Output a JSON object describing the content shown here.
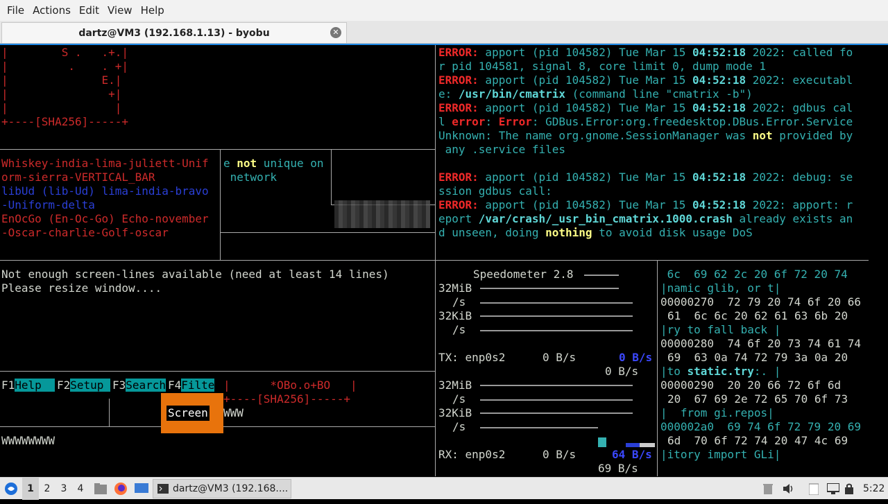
{
  "menubar": {
    "items": [
      "File",
      "Actions",
      "Edit",
      "View",
      "Help"
    ]
  },
  "tab": {
    "title": "dartz@VM3 (192.168.1.13) - byobu"
  },
  "left": {
    "art": [
      "|        S .   .+.|",
      "|         .    . +|",
      "|              E.|",
      "|               +|",
      "|                |",
      "+----[SHA256]-----+"
    ],
    "phon1": "Whiskey-india-lima-juliett-Unif",
    "phon2": "orm-sierra-VERTICAL_BAR",
    "phon3": "libUd (lib-Ud) lima-india-bravo",
    "phon4": "-Uniform-delta",
    "phon5": "EnOcGo (En-Oc-Go) Echo-november",
    "phon6": "-Oscar-charlie-Golf-oscar",
    "mid_pre": "e ",
    "mid_not": "not",
    "mid_post": " unique on",
    "mid_l2": " network",
    "msg1": "Not enough screen-lines available (need at least 14 lines)",
    "msg2": "Please resize window....",
    "fkeys": [
      {
        "num": "F1",
        "label": "Help  "
      },
      {
        "num": "F2",
        "label": "Setup "
      },
      {
        "num": "F3",
        "label": "Search"
      },
      {
        "num": "F4",
        "label": "Filte"
      }
    ],
    "art2_l1": "|      *OBo.o+BO   |",
    "art2_l2": "+----[SHA256]-----+",
    "screen_label": "Screen",
    "www": "WWW",
    "wwww": "WWWWWWWW"
  },
  "errors": {
    "tag": "ERROR:",
    "prefix": " apport (pid 104582) Tue Mar 15 ",
    "time": "04:52:18",
    "l1_post": " 2022: called fo",
    "l2": "r pid 104581, signal 8, core limit 0, dump mode 1",
    "l3_post": " 2022: executabl",
    "l4_pre": "e: ",
    "l4_path": "/usr/bin/cmatrix",
    "l4_post": " (command line \"cmatrix -b\")",
    "l5_post": " 2022: gdbus cal",
    "l6_pre": "l ",
    "l6_error": "error",
    "l6_mid": ": ",
    "l6_Error": "Error",
    "l6_post": ": GDBus.Error:org.freedesktop.DBus.Error.Service",
    "l7_pre": "Unknown: The name org.gnome.SessionManager was ",
    "l7_not": "not",
    "l7_post": " provided by",
    "l8": " any .service files",
    "l9_post": " 2022: debug: se",
    "l10": "ssion gdbus call:",
    "l11_post": " 2022: apport: r",
    "l12_pre": "eport ",
    "l12_path": "/var/crash/_usr_bin_cmatrix.1000.crash",
    "l12_post": " already exists an",
    "l13_pre": "d unseen, doing ",
    "l13_nothing": "nothing",
    "l13_post": " to avoid disk usage DoS"
  },
  "speedometer": {
    "title": "Speedometer 2.8",
    "scale1": "32MiB",
    "unit": "/s",
    "scale2": "32KiB",
    "tx_label": "TX: enp0s2",
    "tx_rate": "0 B/s",
    "tx_cur": "0 B/s",
    "tx_avg": "0 B/s",
    "rx_label": "RX: enp0s2",
    "rx_rate": "0 B/s",
    "rx_cur": "64 B/s",
    "rx_avg": "69 B/s"
  },
  "hexdump": {
    "r1": " 6c  69 62 2c 20 6f 72 20 74",
    "r2": "|namic glib, or t|",
    "r3": "00000270  72 79 20 74 6f 20 66",
    "r4": "61  6c 6c 20 62 61 63 6b 20",
    "r5": "|ry to fall back |",
    "r6": "00000280  74 6f 20 73 74 61 74",
    "r7": "69  63 0a 74 72 79 3a 0a 20",
    "r8a": "|to ",
    "r8b": "static.try",
    "r8c": ":. |",
    "r9": "00000290  20 20 66 72 6f 6d",
    "r10": "20  67 69 2e 72 65 70 6f 73",
    "r11": "|  from gi.repos|",
    "r12": "000002a0  69 74 6f 72 79 20 69",
    "r13": "6d  70 6f 72 74 20 47 4c 69",
    "r14": "|itory import GLi|"
  },
  "taskbar": {
    "workspaces": [
      "1",
      "2",
      "3",
      "4"
    ],
    "task_label": "dartz@VM3 (192.168....",
    "clock": "5:22"
  }
}
